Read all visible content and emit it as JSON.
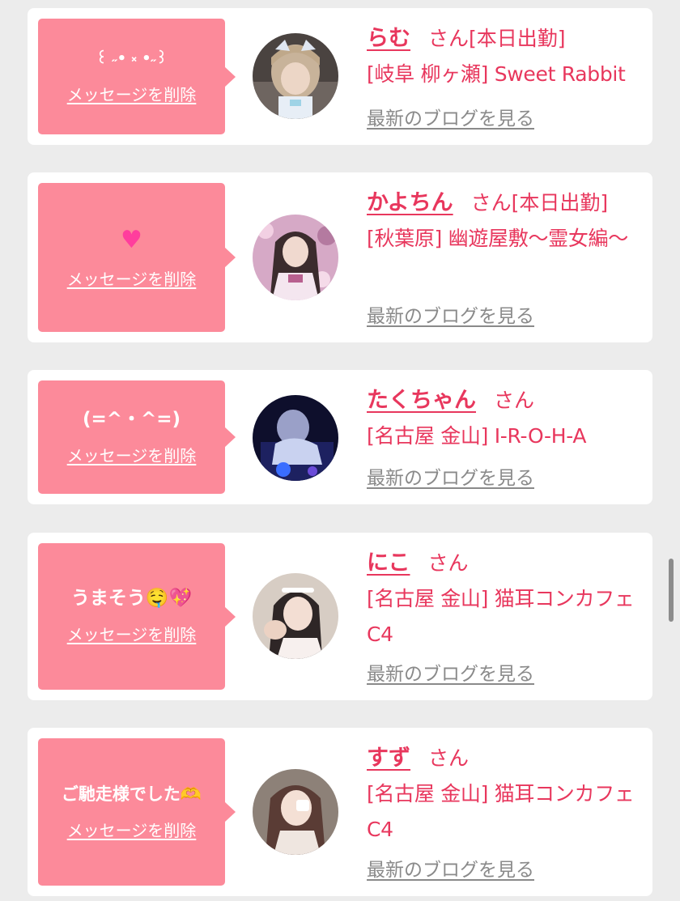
{
  "colors": {
    "page_bg": "#ececec",
    "card_bg": "#ffffff",
    "bubble_bg": "#fc8a9a",
    "accent_text": "#e8375d",
    "link_gray": "#8a8a8a"
  },
  "items": [
    {
      "message": "꒰ ˶• ༝ •˶꒱",
      "delete_label": "メッセージを削除",
      "name": "らむ",
      "honorific": "さん",
      "status": "[本日出勤]",
      "shop": "[岐阜 柳ヶ瀬] Sweet Rabbit",
      "blog_link": "最新のブログを見る",
      "avatar_icon": "girl-photo-avatar"
    },
    {
      "message": "♥",
      "delete_label": "メッセージを削除",
      "name": "かよちん",
      "honorific": "さん",
      "status": "[本日出勤]",
      "shop": "[秋葉原] 幽遊屋敷〜霊女編〜",
      "blog_link": "最新のブログを見る",
      "avatar_icon": "girl-photo-avatar"
    },
    {
      "message": "(=^・^=)",
      "delete_label": "メッセージを削除",
      "name": "たくちゃん",
      "honorific": "さん",
      "status": "",
      "shop": "[名古屋 金山] I-R-O-H-A",
      "blog_link": "最新のブログを見る",
      "avatar_icon": "girl-photo-avatar"
    },
    {
      "message": "うまそう🤤💖",
      "delete_label": "メッセージを削除",
      "name": "にこ",
      "honorific": "さん",
      "status": "",
      "shop": "[名古屋 金山] 猫耳コンカフェ C4",
      "blog_link": "最新のブログを見る",
      "avatar_icon": "girl-photo-avatar"
    },
    {
      "message": "ご馳走様でした🫶",
      "delete_label": "メッセージを削除",
      "name": "すず",
      "honorific": "さん",
      "status": "",
      "shop": "[名古屋 金山] 猫耳コンカフェ C4",
      "blog_link": "最新のブログを見る",
      "avatar_icon": "girl-photo-avatar"
    }
  ]
}
